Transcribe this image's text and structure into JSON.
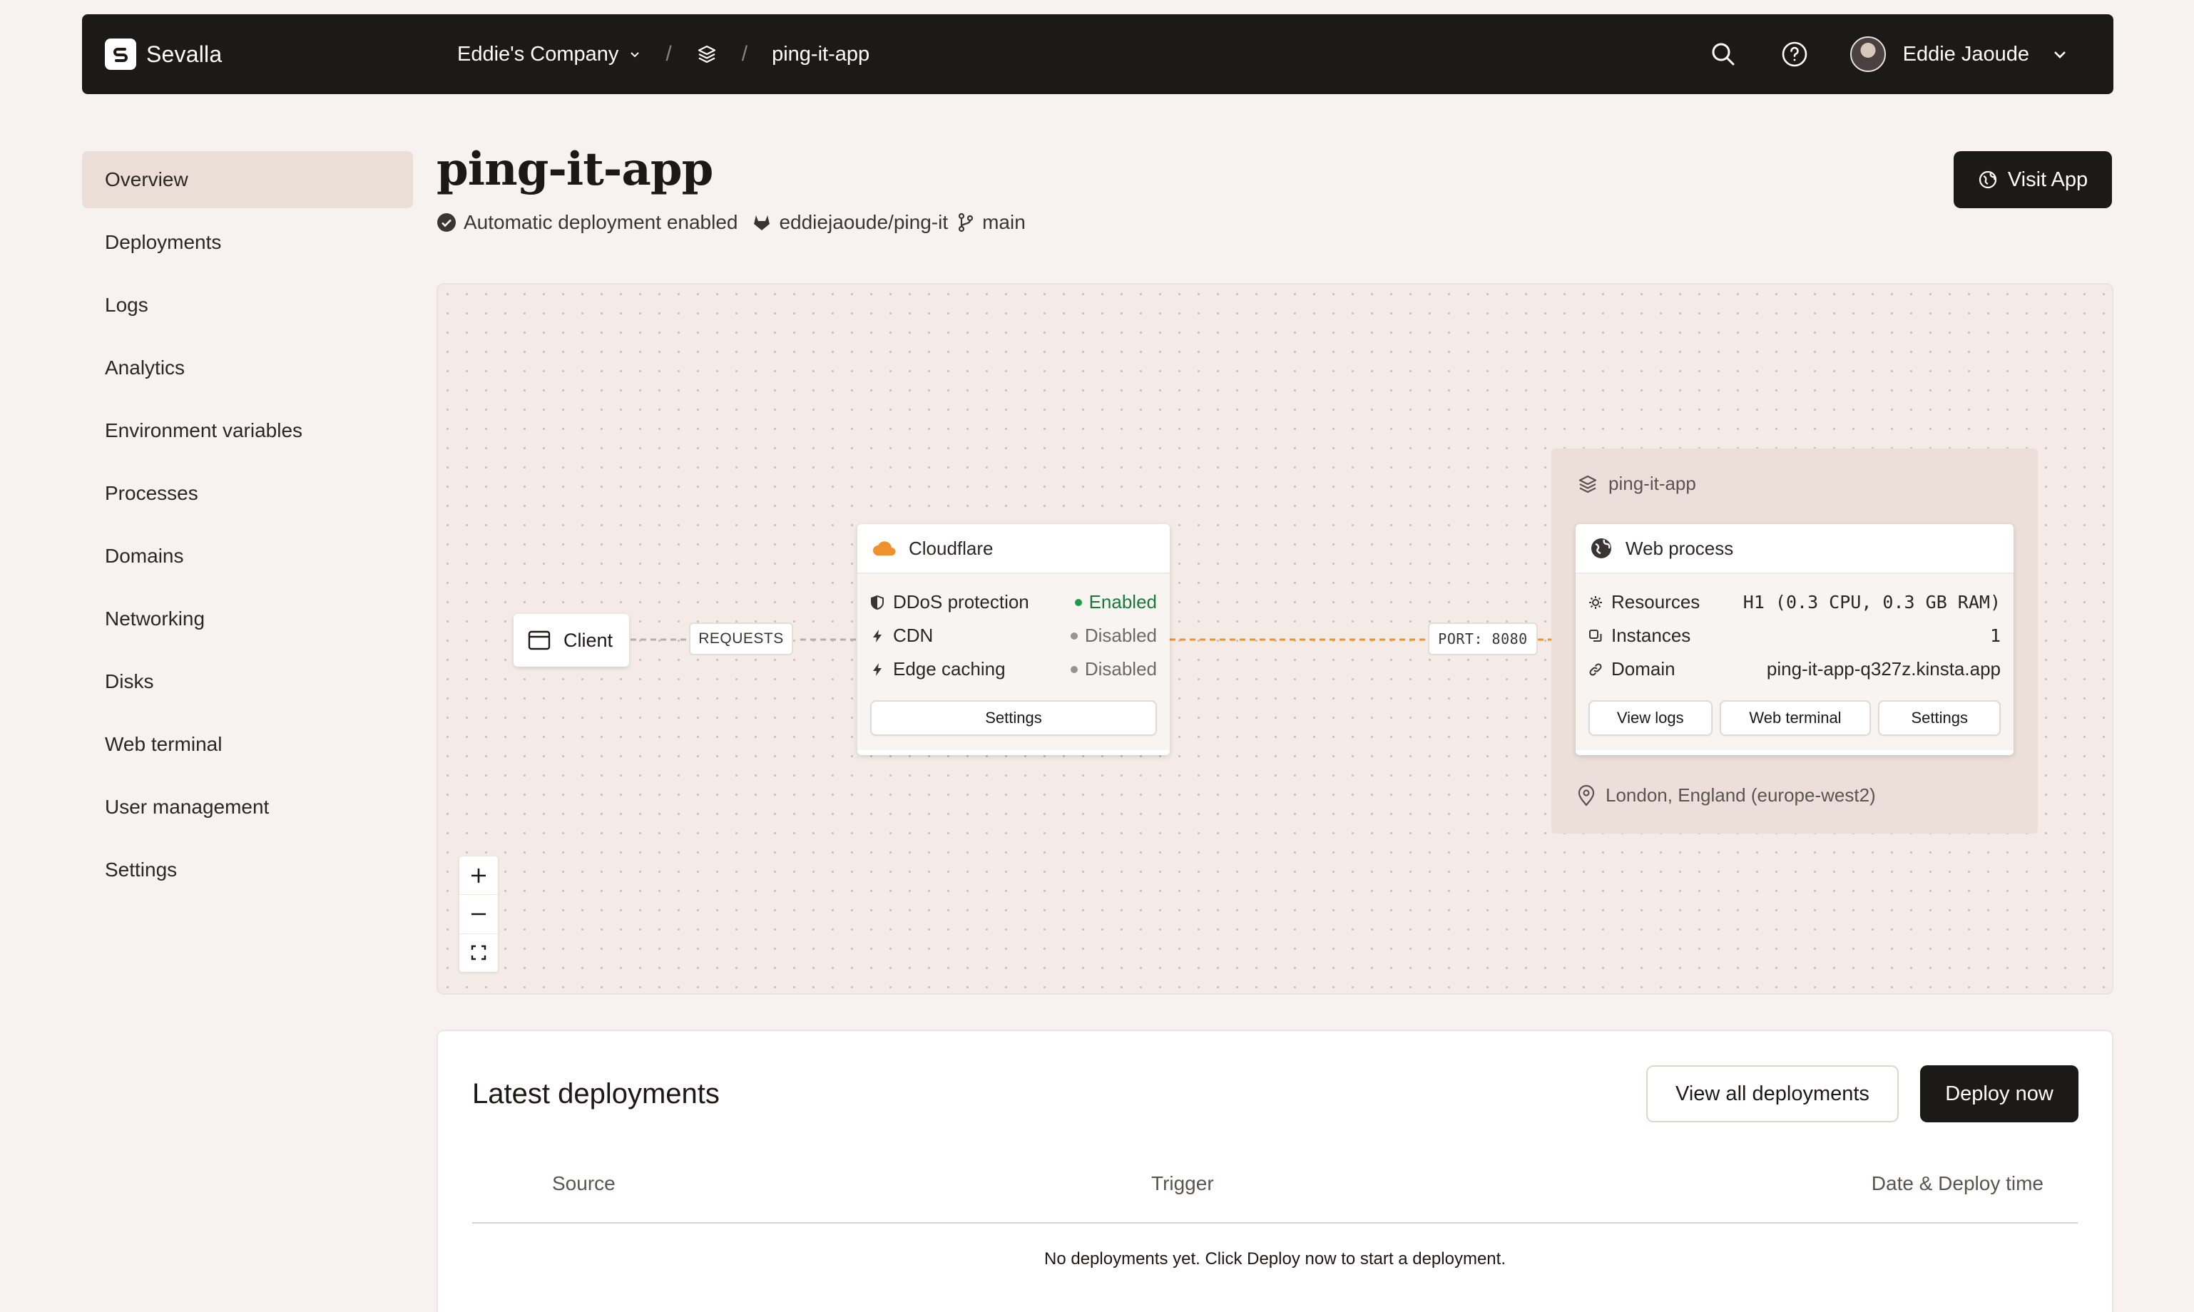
{
  "topbar": {
    "brand": "Sevalla",
    "company": "Eddie's Company",
    "separator": "/",
    "app": "ping-it-app",
    "user_name": "Eddie Jaoude"
  },
  "sidebar": {
    "items": [
      {
        "label": "Overview",
        "active": true
      },
      {
        "label": "Deployments"
      },
      {
        "label": "Logs"
      },
      {
        "label": "Analytics"
      },
      {
        "label": "Environment variables"
      },
      {
        "label": "Processes"
      },
      {
        "label": "Domains"
      },
      {
        "label": "Networking"
      },
      {
        "label": "Disks"
      },
      {
        "label": "Web terminal"
      },
      {
        "label": "User management"
      },
      {
        "label": "Settings"
      }
    ]
  },
  "header": {
    "title": "ping-it-app",
    "auto_deploy": "Automatic deployment enabled",
    "repo": "eddiejaoude/ping-it",
    "branch": "main",
    "visit_label": "Visit App"
  },
  "canvas": {
    "client_label": "Client",
    "requests_label": "REQUESTS",
    "port_label": "PORT: 8080",
    "cloudflare": {
      "title": "Cloudflare",
      "rows": [
        {
          "label": "DDoS protection",
          "status": "Enabled"
        },
        {
          "label": "CDN",
          "status": "Disabled"
        },
        {
          "label": "Edge caching",
          "status": "Disabled"
        }
      ],
      "settings_label": "Settings"
    },
    "app_group": {
      "title": "ping-it-app",
      "location": "London, England (europe-west2)",
      "web_process": {
        "title": "Web process",
        "rows": [
          {
            "label": "Resources",
            "value": "H1 (0.3 CPU, 0.3 GB RAM)"
          },
          {
            "label": "Instances",
            "value": "1"
          },
          {
            "label": "Domain",
            "value": "ping-it-app-q327z.kinsta.app"
          }
        ],
        "buttons": [
          "View logs",
          "Web terminal",
          "Settings"
        ]
      }
    },
    "zoom": {
      "in": "zoom-in-icon",
      "out": "zoom-out-icon",
      "fit": "fit-view-icon"
    }
  },
  "deployments": {
    "title": "Latest deployments",
    "view_all_label": "View all deployments",
    "deploy_label": "Deploy now",
    "columns": [
      "Source",
      "Trigger",
      "Date & Deploy time"
    ],
    "empty_message": "No deployments yet. Click Deploy now to start a deployment."
  },
  "colors": {
    "accent_orange": "#f0922b",
    "enabled_green": "#1f9a47",
    "topbar_bg": "#1c1a19"
  }
}
